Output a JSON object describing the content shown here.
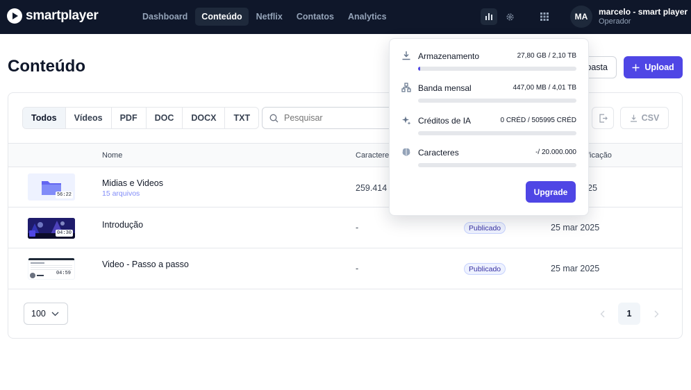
{
  "app": {
    "logo_text": "smartplayer"
  },
  "nav": {
    "items": [
      {
        "label": "Dashboard",
        "active": false
      },
      {
        "label": "Conteúdo",
        "active": true
      },
      {
        "label": "Netflix",
        "active": false
      },
      {
        "label": "Contatos",
        "active": false
      },
      {
        "label": "Analytics",
        "active": false
      }
    ]
  },
  "user": {
    "initials": "MA",
    "name": "marcelo - smart player",
    "role": "Operador"
  },
  "page": {
    "title": "Conteúdo",
    "new_folder_label": "Nova pasta",
    "new_folder_visible": "pasta",
    "upload_label": "Upload"
  },
  "filters": [
    "Todos",
    "Vídeos",
    "PDF",
    "DOC",
    "DOCX",
    "TXT"
  ],
  "search": {
    "placeholder": "Pesquisar"
  },
  "export": {
    "csv_label": "CSV"
  },
  "table": {
    "headers": {
      "name": "Nome",
      "chars": "Caracteres",
      "modified": "ficação"
    },
    "rows": [
      {
        "name": "Midias e Videos",
        "sub": "15 arquivos",
        "duration": "56:22",
        "chars": "259.414",
        "status": "",
        "date": "25"
      },
      {
        "name": "Introdução",
        "sub": "",
        "duration": "04:30",
        "chars": "-",
        "status": "Publicado",
        "date": "25 mar 2025"
      },
      {
        "name": "Video - Passo a passo",
        "sub": "",
        "duration": "04:59",
        "chars": "-",
        "status": "Publicado",
        "date": "25 mar 2025"
      }
    ]
  },
  "pagination": {
    "page_size": "100",
    "current_page": "1"
  },
  "usage": {
    "items": [
      {
        "label": "Armazenamento",
        "value": "27,80 GB / 2,10 TB",
        "fill_percent": 1.3,
        "icon": "download-icon"
      },
      {
        "label": "Banda mensal",
        "value": "447,00 MB / 4,01 TB",
        "fill_percent": 0,
        "icon": "network-icon"
      },
      {
        "label": "Créditos de IA",
        "value": "0 CRÉD / 505995 CRÉD",
        "fill_percent": 0,
        "icon": "sparkles-icon"
      },
      {
        "label": "Caracteres",
        "value": "-/ 20.000.000",
        "fill_percent": 0,
        "icon": "brain-icon"
      }
    ],
    "upgrade_label": "Upgrade"
  },
  "colors": {
    "accent": "#4f46e5",
    "topbar": "#0f172a"
  }
}
